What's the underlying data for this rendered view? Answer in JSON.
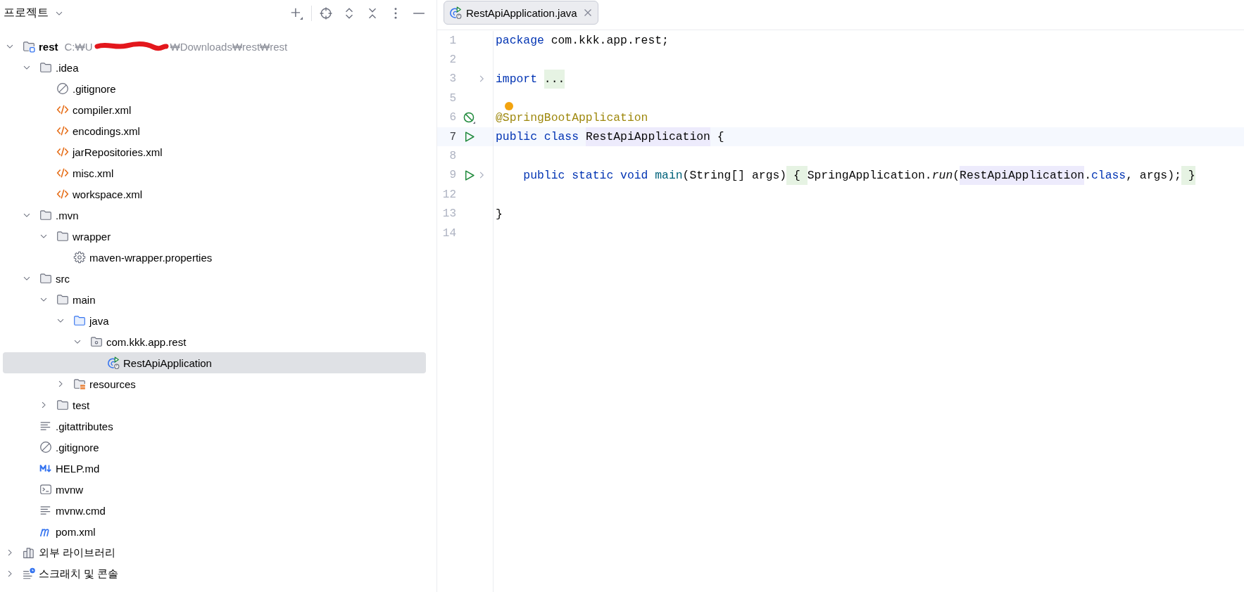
{
  "project_panel": {
    "title": "프로젝트"
  },
  "tree": [
    {
      "label": "rest",
      "kind": "project",
      "expanded": true,
      "selected": false,
      "path": {
        "start": "C:₩U",
        "end": "₩Downloads₩rest₩rest",
        "redacted": true
      },
      "children": [
        {
          "label": ".idea",
          "kind": "folder",
          "expanded": true,
          "selected": false,
          "children": [
            {
              "label": ".gitignore",
              "kind": "ignore",
              "selected": false
            },
            {
              "label": "compiler.xml",
              "kind": "xml",
              "selected": false
            },
            {
              "label": "encodings.xml",
              "kind": "xml",
              "selected": false
            },
            {
              "label": "jarRepositories.xml",
              "kind": "xml",
              "selected": false
            },
            {
              "label": "misc.xml",
              "kind": "xml",
              "selected": false
            },
            {
              "label": "workspace.xml",
              "kind": "xml",
              "selected": false
            }
          ]
        },
        {
          "label": ".mvn",
          "kind": "folder",
          "expanded": true,
          "selected": false,
          "children": [
            {
              "label": "wrapper",
              "kind": "folder",
              "expanded": true,
              "selected": false,
              "children": [
                {
                  "label": "maven-wrapper.properties",
                  "kind": "properties",
                  "selected": false
                }
              ]
            }
          ]
        },
        {
          "label": "src",
          "kind": "folder",
          "expanded": true,
          "selected": false,
          "children": [
            {
              "label": "main",
              "kind": "folder",
              "expanded": true,
              "selected": false,
              "children": [
                {
                  "label": "java",
                  "kind": "source_folder",
                  "expanded": true,
                  "selected": false,
                  "children": [
                    {
                      "label": "com.kkk.app.rest",
                      "kind": "package",
                      "expanded": true,
                      "selected": false,
                      "children": [
                        {
                          "label": "RestApiApplication",
                          "kind": "spring_class",
                          "selected": true
                        }
                      ]
                    }
                  ]
                },
                {
                  "label": "resources",
                  "kind": "resources_folder",
                  "expanded": false,
                  "selected": false
                }
              ]
            },
            {
              "label": "test",
              "kind": "folder",
              "expanded": false,
              "selected": false
            }
          ]
        },
        {
          "label": ".gitattributes",
          "kind": "text",
          "selected": false
        },
        {
          "label": ".gitignore",
          "kind": "ignore",
          "selected": false
        },
        {
          "label": "HELP.md",
          "kind": "markdown",
          "selected": false
        },
        {
          "label": "mvnw",
          "kind": "shell",
          "selected": false
        },
        {
          "label": "mvnw.cmd",
          "kind": "text",
          "selected": false
        },
        {
          "label": "pom.xml",
          "kind": "maven",
          "selected": false
        }
      ]
    },
    {
      "label": "외부 라이브러리",
      "kind": "library",
      "expanded": false,
      "selected": false
    },
    {
      "label": "스크래치 및 콘솔",
      "kind": "scratch",
      "expanded": false,
      "selected": false
    }
  ],
  "editor": {
    "tabs": [
      {
        "label": "RestApiApplication.java",
        "kind": "spring_class",
        "selected": true
      }
    ],
    "lines": [
      {
        "number": "1",
        "kind": "plain",
        "current": false,
        "folded": false,
        "hint": false,
        "indented": false,
        "tokens": [
          {
            "text": "package",
            "kind": "keyword"
          },
          {
            "text": " com.kkk.app.rest;",
            "kind": "plain"
          }
        ]
      },
      {
        "number": "2",
        "kind": "plain",
        "current": false,
        "folded": false,
        "hint": false
      },
      {
        "number": "3",
        "kind": "plain",
        "current": false,
        "folded": true,
        "hint": false,
        "indented": false,
        "tokens": [
          {
            "text": "import ",
            "kind": "keyword"
          },
          {
            "text": "...",
            "kind": "fold"
          }
        ]
      },
      {
        "number": "5",
        "kind": "plain",
        "current": false,
        "folded": false,
        "hint": false
      },
      {
        "number": "6",
        "kind": "bean",
        "current": false,
        "folded": false,
        "hint": true,
        "indented": false,
        "tokens": [
          {
            "text": "@SpringBootApplication",
            "kind": "annotation"
          }
        ]
      },
      {
        "number": "7",
        "kind": "run",
        "current": true,
        "folded": false,
        "hint": false,
        "indented": false,
        "tokens": [
          {
            "text": "public class ",
            "kind": "keyword"
          },
          {
            "text": "RestApiApplication",
            "kind": "usage"
          },
          {
            "text": " {",
            "kind": "plain"
          }
        ]
      },
      {
        "number": "8",
        "kind": "plain",
        "current": false,
        "folded": false,
        "hint": false
      },
      {
        "number": "9",
        "kind": "run",
        "current": false,
        "folded": true,
        "hint": false,
        "indented": true,
        "tokens": [
          {
            "text": "public static void ",
            "kind": "keyword"
          },
          {
            "text": "main",
            "kind": "method"
          },
          {
            "text": "(String[] args)",
            "kind": "plain"
          },
          {
            "text": " { ",
            "kind": "fold"
          },
          {
            "text": "SpringApplication.",
            "kind": "plain"
          },
          {
            "text": "run",
            "kind": "static_call"
          },
          {
            "text": "(",
            "kind": "plain"
          },
          {
            "text": "RestApiApplication",
            "kind": "usage"
          },
          {
            "text": ".",
            "kind": "plain"
          },
          {
            "text": "class",
            "kind": "keyword"
          },
          {
            "text": ", args);",
            "kind": "plain"
          },
          {
            "text": " }",
            "kind": "fold"
          }
        ]
      },
      {
        "number": "12",
        "kind": "plain",
        "current": false,
        "folded": false,
        "hint": false
      },
      {
        "number": "13",
        "kind": "plain",
        "current": false,
        "folded": false,
        "hint": false,
        "indented": false,
        "tokens": [
          {
            "text": "}",
            "kind": "plain"
          }
        ]
      },
      {
        "number": "14",
        "kind": "plain",
        "current": false,
        "folded": false,
        "hint": false
      }
    ]
  }
}
